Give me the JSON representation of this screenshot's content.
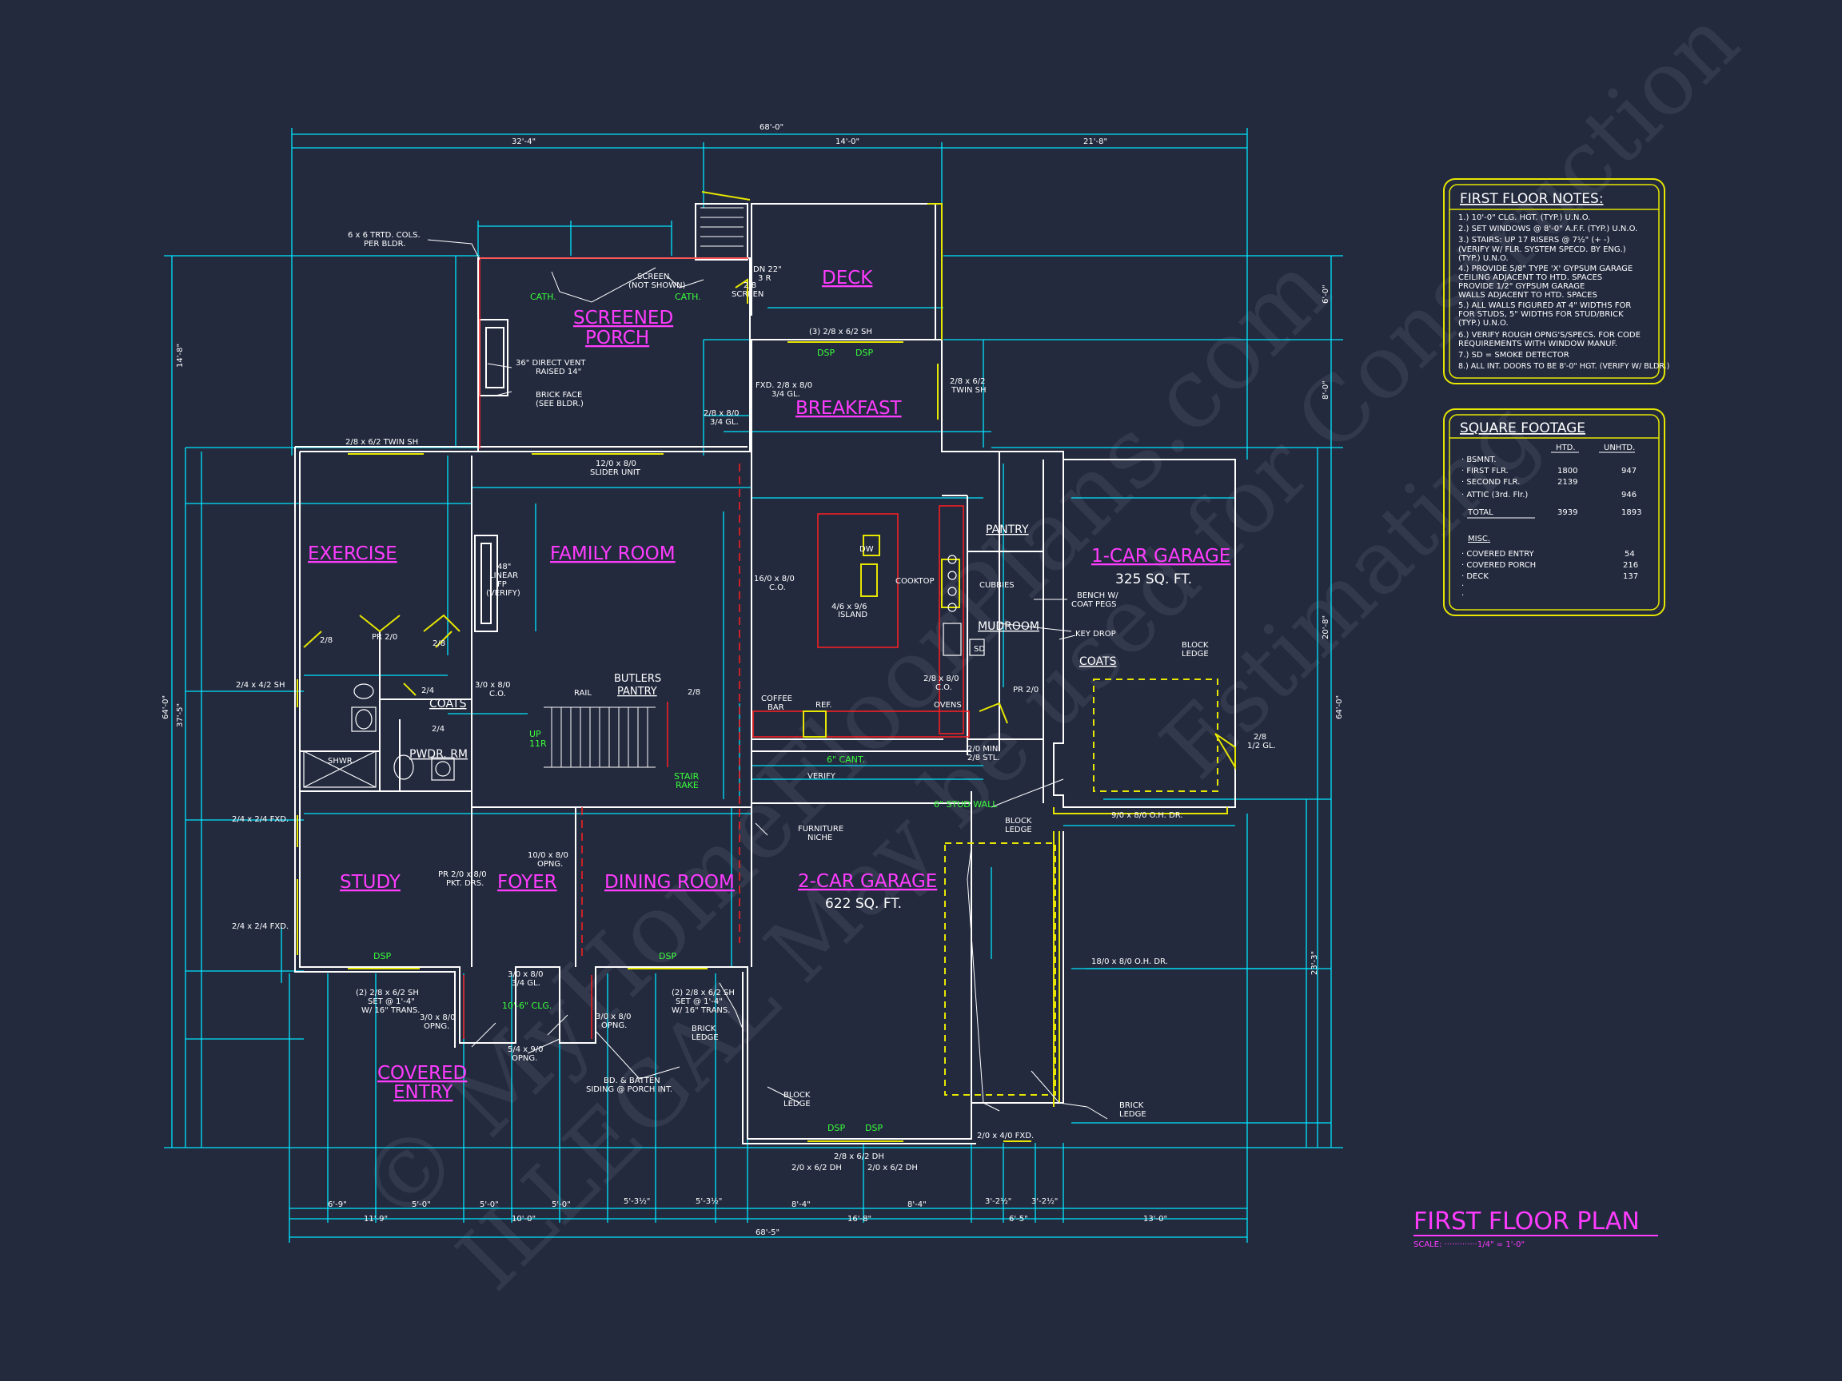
{
  "colors": {
    "background": "#232a3e",
    "dimension": "#00e5ff",
    "wall": "#ffffff",
    "room_label": "#ff3cff",
    "note_box": "#e6e600",
    "green_text": "#39ff39",
    "red_line": "#ff2020"
  },
  "title": {
    "main": "FIRST FLOOR PLAN",
    "scale": "SCALE: ·············1/4\" = 1'-0\""
  },
  "watermark": {
    "line1": "© MyHomeFloorPlans.com",
    "line2": "ILLEGAL May be used for Construction",
    "line3": "Estimating"
  },
  "rooms": {
    "deck": "DECK",
    "screened_porch_1": "SCREENED",
    "screened_porch_2": "PORCH",
    "breakfast": "BREAKFAST",
    "exercise": "EXERCISE",
    "family_room": "FAMILY ROOM",
    "garage1": "1-CAR GARAGE",
    "garage1_sqft": "325 SQ. FT.",
    "garage2": "2-CAR GARAGE",
    "garage2_sqft": "622 SQ. FT.",
    "study": "STUDY",
    "foyer": "FOYER",
    "dining_room": "DINING ROOM",
    "covered_entry_1": "COVERED",
    "covered_entry_2": "ENTRY",
    "pantry": "PANTRY",
    "mudroom": "MUDROOM",
    "coats_mud": "COATS",
    "coats_hall": "COATS",
    "butlers_1": "BUTLERS",
    "butlers_2": "PANTRY",
    "pwdr": "PWDR. RM"
  },
  "overall_dims": {
    "top_total": "68'-0\"",
    "top_a": "32'-4\"",
    "top_b": "14'-0\"",
    "top_c": "21'-8\"",
    "bottom_total": "68'-5\"",
    "bottom_a": "11'-9\"",
    "bottom_b": "10'-0\"",
    "bottom_c": "16'-8\"",
    "bottom_d": "6'-5\"",
    "bottom_e": "13'-0\"",
    "bottom_f": "6'-9\"",
    "bottom_g": "5'-0\"",
    "bottom_h": "5'-0\"",
    "bottom_i": "5'-0\"",
    "bottom_j": "5'-3½\"",
    "bottom_k": "5'-3½\"",
    "bottom_l": "8'-4\"",
    "bottom_m": "8'-4\"",
    "bottom_n": "3'-2½\"",
    "bottom_o": "3'-2½\"",
    "left_total": "64'-0\"",
    "left_a": "37'-5\"",
    "left_b": "14'-8\"",
    "right_total": "64'-0\"",
    "right_a": "20'-8\"",
    "right_b": "23'-3\"",
    "right_c": "6'-0\"",
    "right_d": "8'-0\""
  },
  "labels": {
    "cols": "6 x 6 TRTD. COLS.",
    "cols2": "PER BLDR.",
    "screen": "SCREEN",
    "screen2": "(NOT SHOWN)",
    "cath1": "CATH.",
    "cath2": "CATH.",
    "vent1": "36\" DIRECT VENT",
    "vent2": "RAISED 14\"",
    "brickface1": "BRICK FACE",
    "brickface2": "(SEE BLDR.)",
    "dn": "DN 22\"",
    "dn2": "3 R",
    "screen_door1": "2/8",
    "screen_door2": "SCREEN",
    "deck_window": "(3) 2/8 x 6/2 SH",
    "dsp1": "DSP",
    "dsp2": "DSP",
    "fxd1": "FXD. 2/8 x 8/0",
    "fxd2": "3/4 GL.",
    "door28": "2/8 x 8/0",
    "door28b": "3/4 GL.",
    "bk_window": "2/8 x 6/2",
    "bk_window2": "TWIN SH",
    "twin_sh": "2/8 x 6/2 TWIN SH",
    "slider": "12/0 x 8/0",
    "slider2": "SLIDER UNIT",
    "linear1": "48\"",
    "linear2": "LINEAR",
    "linear3": "FP",
    "linear4": "(VERIFY)",
    "co1": "16/0 x 8/0",
    "co2": "C.O.",
    "dw": "DW",
    "island1": "4/6 x 9/6",
    "island2": "ISLAND",
    "cooktop": "COOKTOP",
    "cubbies": "CUBBIES",
    "bench1": "BENCH W/",
    "bench2": "COAT PEGS",
    "keydrop": "KEY DROP",
    "block_ledge1": "BLOCK",
    "block_ledge2": "LEDGE",
    "pr28": "PR 2/0",
    "pr2": "PR 2/0",
    "sh24": "2/4 x 4/2 SH",
    "door30": "3/0 x 8/0",
    "door30b": "C.O.",
    "rail": "RAIL",
    "coffee1": "COFFEE",
    "coffee2": "BAR",
    "ref": "REF.",
    "ovens": "OVENS",
    "co28": "2/8 x 8/0",
    "co28b": "C.O.",
    "min1": "2/0 MIN",
    "min2": "2/8 STL.",
    "gl28": "2/8",
    "gl28b": "1/2 GL.",
    "cant": "6\" CANT.",
    "verify": "VERIFY",
    "up1": "UP",
    "up2": "11R",
    "stair1": "STAIR",
    "stair2": "RAKE",
    "shwr": "SHWR.",
    "fxd24": "2/4 x 2/4 FXD.",
    "fxd24b": "2/4 x 2/4 FXD.",
    "stud_wall": "6\" STUD WALL",
    "niche1": "FURNITURE",
    "niche2": "NICHE",
    "ohdr1": "9/0 x 8/0 O.H. DR.",
    "ohdr2": "18/0 x 8/0 O.H. DR.",
    "opng1": "10/0 x 8/0",
    "opng2": "OPNG.",
    "pkt1": "PR 2/0 x 8/0",
    "pkt2": "PKT. DRS.",
    "sh26_1": "(2) 2/8 x 6/2 SH",
    "sh26_2": "SET @ 1'-4\"",
    "sh26_3": "W/ 16\" TRANS.",
    "sh26b_1": "(2) 2/8 x 6/2 SH",
    "sh26b_2": "SET @ 1'-4\"",
    "sh26b_3": "W/ 16\" TRANS.",
    "opng30": "3/0 x 8/0",
    "opng30b": "OPNG.",
    "door38": "3/0 x 8/0",
    "door38b": "3/4 GL.",
    "clg": "10'-6\" CLG.",
    "opng54": "5/4 x 9/0",
    "opng54b": "OPNG.",
    "opng30c": "3/0 x 8/0",
    "opng30d": "OPNG.",
    "brick_ledge": "BRICK",
    "brick_ledge2": "LEDGE",
    "batten1": "BD. & BATTEN",
    "batten2": "SIDING @ PORCH INT.",
    "dh1": "2/8 x 6/2 DH",
    "dh2": "2/0 x 6/2 DH",
    "dh3": "2/0 x 6/2 DH",
    "fxd40": "2/0 x 4/0 FXD.",
    "dsp3": "DSP",
    "dsp4": "DSP",
    "dsp5": "DSP",
    "dsp6": "DSP",
    "sd": "SD",
    "coats24": "2/4",
    "door24": "2/4",
    "door28c": "2/8",
    "door28d": "2/8",
    "door28e": "2/8"
  },
  "notes_box": {
    "title": "FIRST FLOOR NOTES:",
    "lines": [
      "1.) 10'-0\" CLG. HGT. (TYP.) U.N.O.",
      "2.) SET WINDOWS @ 8'-0\" A.F.F. (TYP.) U.N.O.",
      "3.) STAIRS: UP 17 RISERS @ 7½\" (+ -)",
      "     (VERIFY W/ FLR. SYSTEM SPECD. BY ENG.)",
      "     (TYP.) U.N.O.",
      "4.) PROVIDE 5/8\" TYPE 'X' GYPSUM GARAGE",
      "     CEILING ADJACENT TO HTD. SPACES",
      "     PROVIDE 1/2\" GYPSUM GARAGE",
      "     WALLS ADJACENT TO HTD. SPACES",
      "5.) ALL WALLS FIGURED AT 4\" WIDTHS FOR",
      "     FOR STUDS, 5\" WIDTHS FOR STUD/BRICK",
      "     (TYP.) U.N.O.",
      "6.) VERIFY ROUGH OPNG'S/SPECS. FOR CODE",
      "     REQUIREMENTS WITH WINDOW MANUF.",
      "7.) SD = SMOKE DETECTOR",
      "8.) ALL INT. DOORS TO BE 8'-0\" HGT. (VERIFY W/ BLDR.)"
    ]
  },
  "sqft_box": {
    "title": "SQUARE FOOTAGE",
    "col1": "HTD.",
    "col2": "UNHTD.",
    "rows": [
      {
        "label": "· BSMNT.",
        "htd": "",
        "unhtd": ""
      },
      {
        "label": "· FIRST FLR.",
        "htd": "1800",
        "unhtd": "947"
      },
      {
        "label": "· SECOND FLR.",
        "htd": "2139",
        "unhtd": ""
      },
      {
        "label": "· ATTIC (3rd. Flr.)",
        "htd": "",
        "unhtd": "946"
      },
      {
        "label": "TOTAL",
        "htd": "3939",
        "unhtd": "1893"
      }
    ],
    "misc": "MISC.",
    "misc_rows": [
      {
        "label": "· COVERED ENTRY",
        "val": "54"
      },
      {
        "label": "· COVERED PORCH",
        "val": "216"
      },
      {
        "label": "· DECK",
        "val": "137"
      },
      {
        "label": "·",
        "val": ""
      },
      {
        "label": "·",
        "val": ""
      }
    ]
  }
}
